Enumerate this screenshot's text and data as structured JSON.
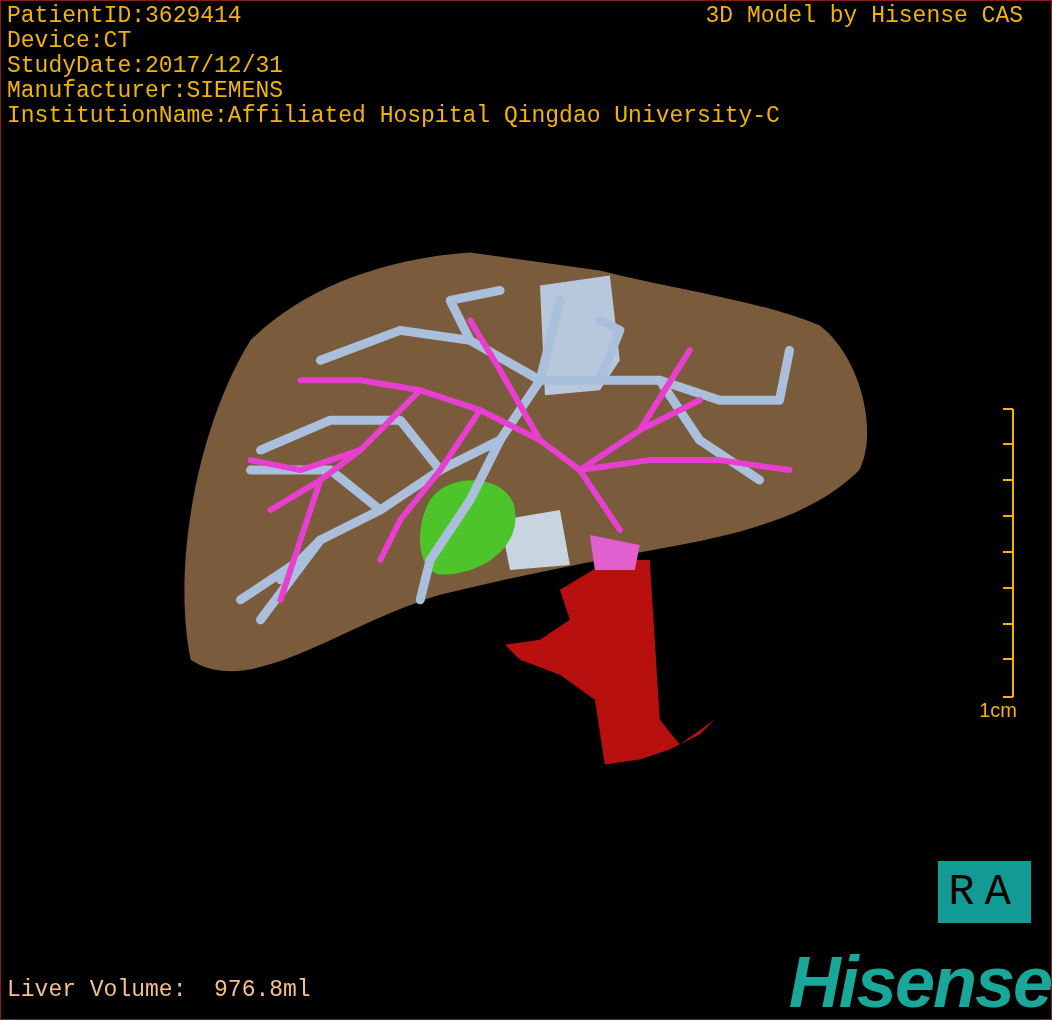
{
  "info_lines": [
    "PatientID:3629414",
    "Device:CT",
    "StudyDate:2017/12/31",
    "Manufacturer:SIEMENS",
    "InstitutionName:Affiliated Hospital Qingdao University-C"
  ],
  "title": "3D Model by Hisense CAS",
  "scale": {
    "label": "1cm"
  },
  "orientation_label": "RA",
  "liver_volume": "Liver Volume:  976.8ml",
  "logo": "Hisense"
}
